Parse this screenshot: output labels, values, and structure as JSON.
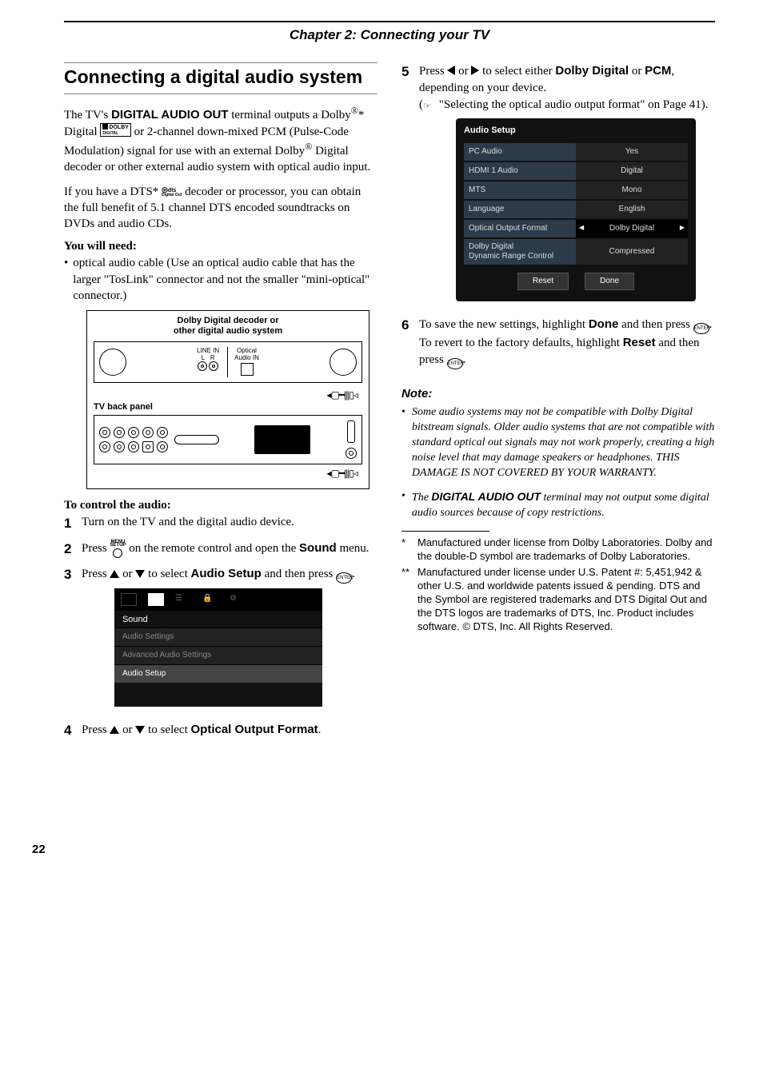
{
  "header": "Chapter 2: Connecting your TV",
  "h1": "Connecting a digital audio system",
  "p1a": "The TV's ",
  "p1b": "DIGITAL AUDIO OUT",
  "p1c": " terminal outputs a Dolby",
  "p1d": "* Digital ",
  "p1e": " or 2-channel down-mixed PCM (Pulse-Code Modulation) signal for use with an external Dolby",
  "p1f": " Digital decoder or other external audio system with optical audio input.",
  "p2a": "If you have a DTS* ",
  "p2b": " decoder or processor, you can obtain the full benefit of 5.1 channel DTS encoded soundtracks on DVDs and audio CDs.",
  "need_h": "You will need:",
  "need_1": "optical audio cable (Use an optical audio cable that has the larger \"TosLink\" connector and not the smaller \"mini-optical\" connector.)",
  "diag": {
    "top": "Dolby Digital decoder or\nother digital audio system",
    "linein": "LINE IN",
    "l": "L",
    "r": "R",
    "optin": "Optical\nAudio IN",
    "tv": "TV back panel"
  },
  "ctrl_h": "To control the audio:",
  "s1": "Turn on the TV and the digital audio device.",
  "s2a": "Press ",
  "s2b": " on the remote control and open the ",
  "s2c": "Sound",
  "s2d": " menu.",
  "s3a": "Press ",
  "s3b": " or ",
  "s3c": " to select ",
  "s3d": "Audio Setup",
  "s3e": " and then press ",
  "s3f": ".",
  "osd": {
    "title": "Sound",
    "r1": "Audio Settings",
    "r2": "Advanced Audio Settings",
    "r3": "Audio Setup"
  },
  "s4a": "Press ",
  "s4b": " or ",
  "s4c": " to select ",
  "s4d": "Optical Output Format",
  "s4e": ".",
  "s5a": "Press ",
  "s5b": " or ",
  "s5c": " to select either ",
  "s5d": "Dolby Digital",
  "s5e": " or ",
  "s5f": "PCM",
  "s5g": ", depending on your device.",
  "s5h": "(",
  "s5i": " \"Selecting the optical audio output format\" on Page 41).",
  "osd2": {
    "title": "Audio Setup",
    "rows": [
      {
        "k": "PC Audio",
        "v": "Yes"
      },
      {
        "k": "HDMI 1 Audio",
        "v": "Digital"
      },
      {
        "k": "MTS",
        "v": "Mono"
      },
      {
        "k": "Language",
        "v": "English"
      },
      {
        "k": "Optical Output Format",
        "v": "Dolby Digital"
      },
      {
        "k": "Dolby Digital\nDynamic Range Control",
        "v": "Compressed"
      }
    ],
    "reset": "Reset",
    "done": "Done"
  },
  "s6a": "To save the new settings, highlight ",
  "s6b": "Done",
  "s6c": " and then press ",
  "s6d": ".",
  "s6e": "To revert to the factory defaults, highlight ",
  "s6f": "Reset",
  "s6g": " and then press ",
  "s6h": ".",
  "note_h": "Note:",
  "note1": "Some audio systems may not be compatible with Dolby Digital bitstream signals. Older audio systems that are not compatible with standard optical out signals may not work properly, creating a high noise level that may damage speakers or headphones. THIS DAMAGE IS NOT COVERED BY YOUR WARRANTY.",
  "note2a": "The ",
  "note2b": "DIGITAL AUDIO OUT",
  "note2c": " terminal may not output some digital audio sources because of copy restrictions.",
  "fn1": "Manufactured under license from Dolby Laboratories. Dolby and the double-D symbol are trademarks of Dolby Laboratories.",
  "fn2": "Manufactured under license under U.S. Patent #: 5,451,942 & other U.S. and worldwide patents issued & pending. DTS and the Symbol are registered trademarks and DTS Digital Out and the DTS logos are trademarks of DTS, Inc. Product includes software. © DTS, Inc. All Rights Reserved.",
  "menu_top": "MENU",
  "menu_bot": "SETUP",
  "enter": "ENTER",
  "dolby_logo": "DOLBY",
  "dolby_sub": "DIGITAL",
  "dts_top": "dts",
  "dts_bot": "Digital Out",
  "pg": "22"
}
